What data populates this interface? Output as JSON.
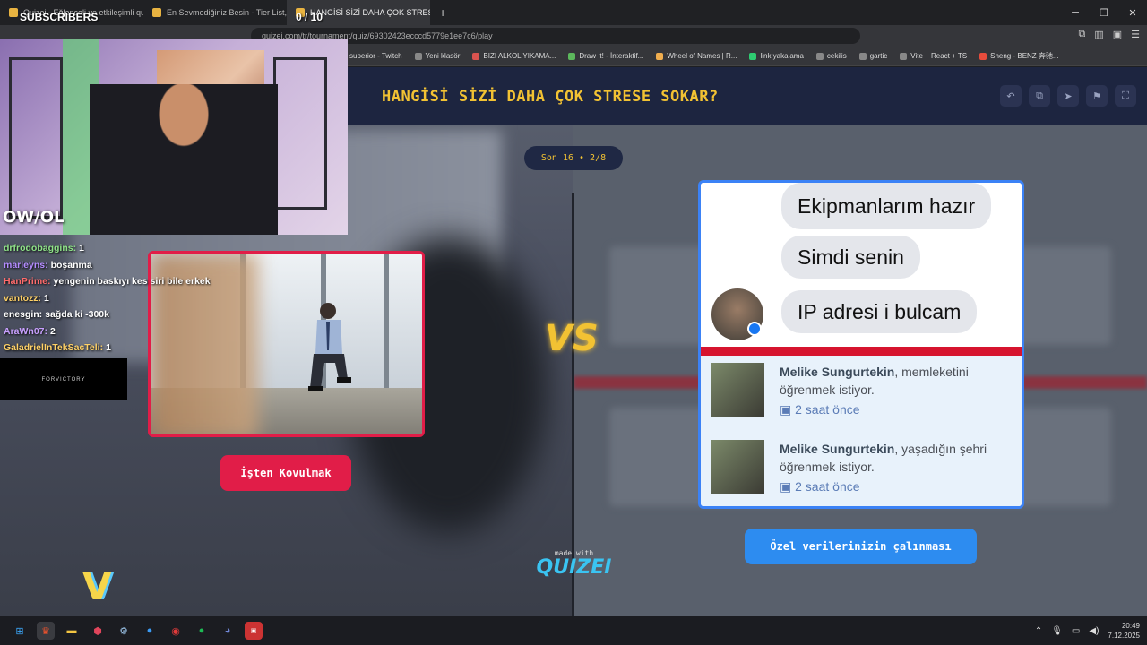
{
  "browser": {
    "tabs": [
      {
        "label": "Quizei - Eğlenceli ve etkileşimli quiz",
        "active": false
      },
      {
        "label": "En Sevmediğiniz Besin - Tier List, Ko",
        "active": false
      },
      {
        "label": "HANGİSİ SİZİ DAHA ÇOK STRESE",
        "active": true
      }
    ],
    "new_tab": "+",
    "url": "quizei.com/tr/tournament/quiz/69302423ecccd5779e1ee7c6/play",
    "bookmarks": [
      "superior - Twitch",
      "Yeni klasör",
      "BIZI ALKOL YIKAMA...",
      "Draw It! - İnteraktif...",
      "Wheel of Names | R...",
      "link yakalama",
      "cekilis",
      "gartic",
      "Vite + React + TS",
      "Sheng - BENZ 奔驰..."
    ]
  },
  "quiz": {
    "title": "HANGİSİ SİZİ DAHA ÇOK STRESE SOKAR?",
    "round": "Son 16 • 2/8",
    "vs": "VS",
    "option_left": {
      "label": "İşten Kovulmak"
    },
    "option_right": {
      "label": "Özel verilerinizin çalınması",
      "bubbles": [
        "Ekipmanlarım hazır",
        "Simdi senin",
        "IP adresi i bulcam"
      ],
      "notifications": [
        {
          "name": "Melike Sungurtekin",
          "text": ", memleketini öğrenmek istiyor.",
          "time": "2 saat önce"
        },
        {
          "name": "Melike Sungurtekin",
          "text": ", yaşadığın şehri öğrenmek istiyor.",
          "time": "2 saat önce"
        }
      ]
    },
    "made_with": "made with",
    "brand": "QUIZEI"
  },
  "stream": {
    "subscribers_label": "SUBSCRIBERS",
    "subscribers_count": "0 / 10",
    "brand_tag": "OW/OL",
    "sponsor": "FORVICTORY",
    "chat": [
      {
        "user": "drfrodobaggins:",
        "msg": "1",
        "color": "#8fe388"
      },
      {
        "user": "marleyns:",
        "msg": "boşanma",
        "color": "#b48cff"
      },
      {
        "user": "HanPrime:",
        "msg": "yengenin baskıyı kes siri bile erkek",
        "color": "#ff6b6b"
      },
      {
        "user": "vantozz:",
        "msg": "1",
        "color": "#ffd166"
      },
      {
        "user": "enesgin:",
        "msg": "sağda ki -300k",
        "color": "#ffffff"
      },
      {
        "user": "AraWn07:",
        "msg": "2",
        "color": "#c9a0ff"
      },
      {
        "user": "GaladrielInTekSacTeli:",
        "msg": "1",
        "color": "#ffd166"
      }
    ]
  },
  "taskbar": {
    "time": "20:49",
    "date": "7.12.2025"
  }
}
